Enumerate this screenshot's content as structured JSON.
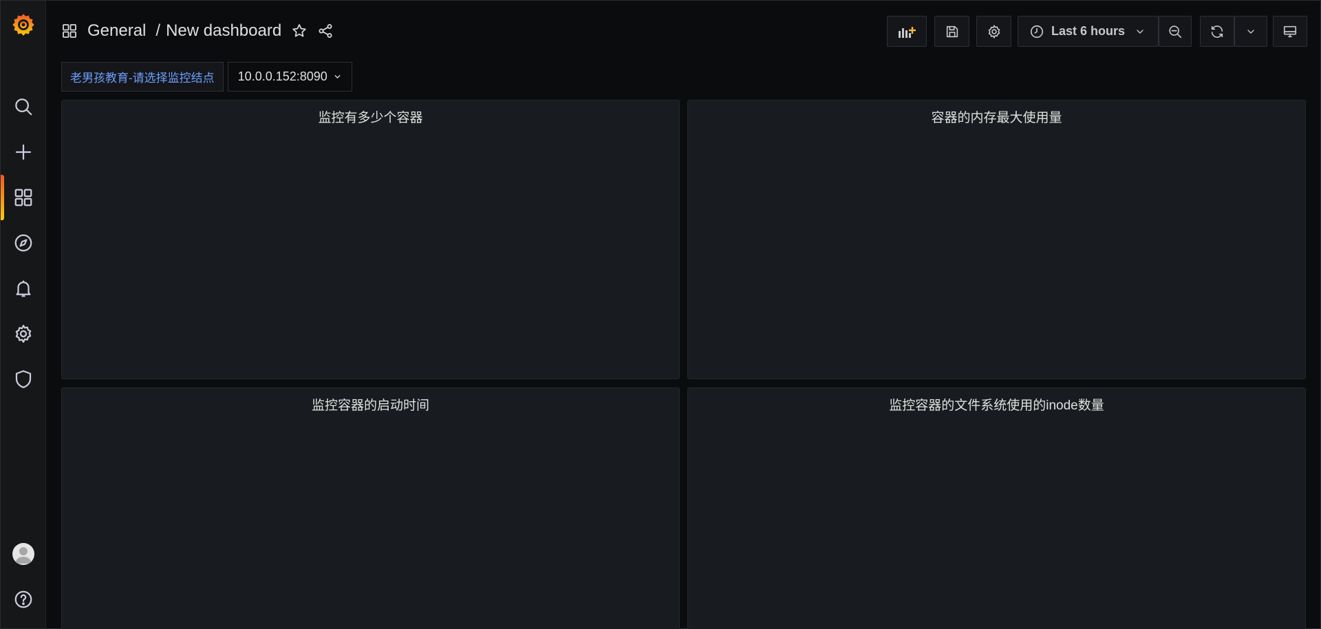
{
  "breadcrumb": {
    "folder": "General",
    "separator": "/",
    "dashboard": "New dashboard"
  },
  "toolbar": {
    "time_range": "Last 6 hours"
  },
  "variables": {
    "label": "老男孩教育-请选择监控结点",
    "value": "10.0.0.152:8090"
  },
  "panels": [
    {
      "title": "监控有多少个容器"
    },
    {
      "title": "容器的内存最大使用量"
    },
    {
      "title": "监控容器的启动时间"
    },
    {
      "title": "监控容器的文件系统使用的inode数量"
    }
  ],
  "sidebar": {
    "items": [
      "search-icon",
      "plus-icon",
      "dashboards-icon",
      "explore-icon",
      "alerting-icon",
      "configuration-icon",
      "shield-icon"
    ],
    "active": "dashboards-icon"
  },
  "colors": {
    "accent": "#f05a28",
    "link": "#6e9fff",
    "panel_bg": "#181b1f",
    "page_bg": "#0b0c0e"
  }
}
